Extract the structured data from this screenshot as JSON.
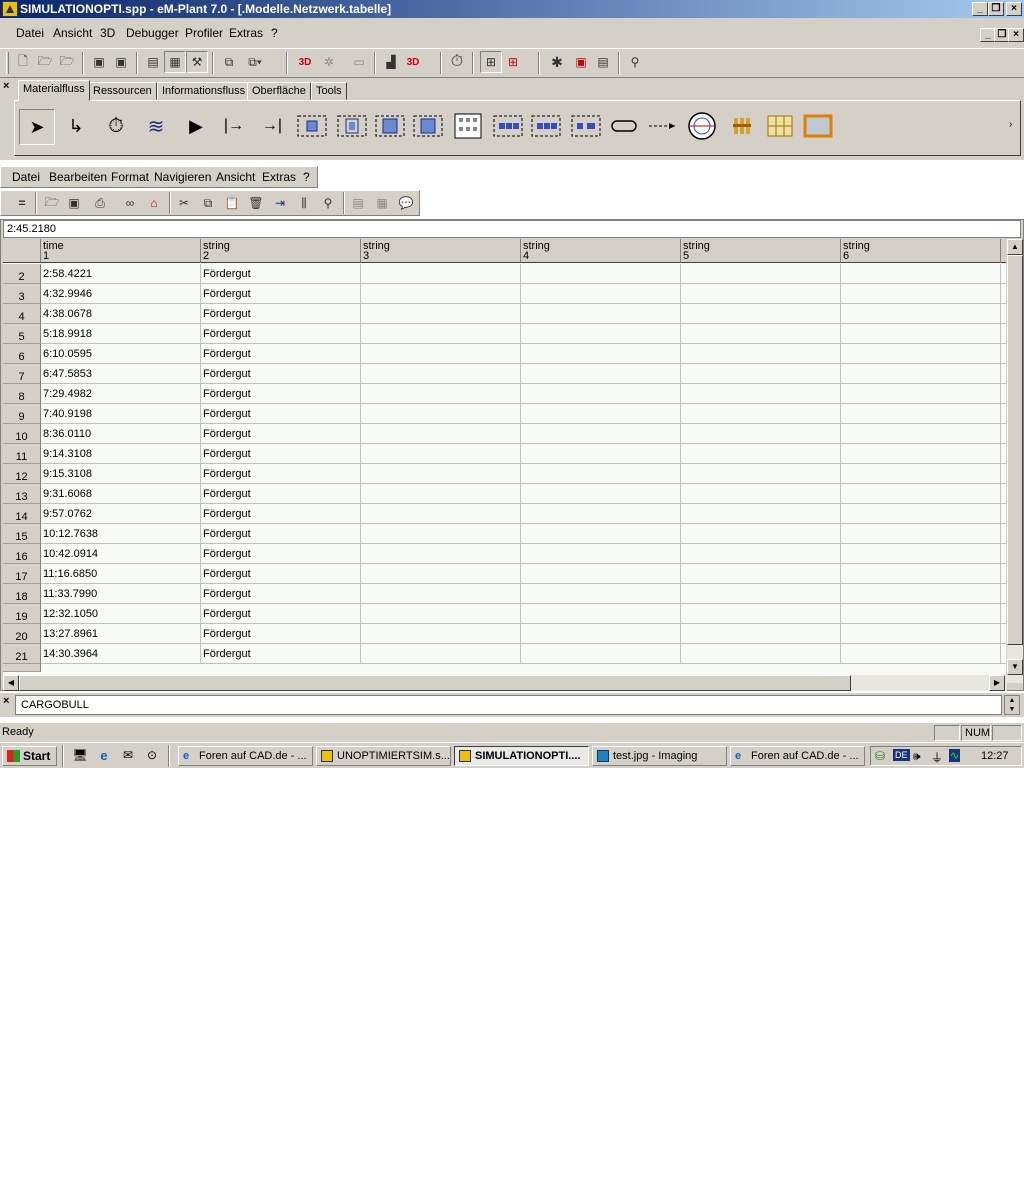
{
  "window": {
    "title": "SIMULATIONOPTI.spp - eM-Plant 7.0 - [.Modelle.Netzwerk.tabelle]",
    "buttons": [
      "_",
      "❐",
      "×"
    ]
  },
  "menu": {
    "items": [
      "Datei",
      "Ansicht",
      "3D",
      "Debugger",
      "Profiler",
      "Extras",
      "?"
    ]
  },
  "toolbar1": {
    "labels": {
      "btn3d": "3D",
      "btn3dlog": "3D"
    }
  },
  "library": {
    "tabs": [
      "Materialfluss",
      "Ressourcen",
      "Informationsfluss",
      "Oberfläche",
      "Tools"
    ],
    "active_tab": "Materialfluss"
  },
  "menu2": {
    "items": [
      "Datei",
      "Bearbeiten",
      "Format",
      "Navigieren",
      "Ansicht",
      "Extras",
      "?"
    ]
  },
  "table": {
    "edit_value": "2:45.2180",
    "columns": [
      {
        "type": "time",
        "index": "1"
      },
      {
        "type": "string",
        "index": "2"
      },
      {
        "type": "string",
        "index": "3"
      },
      {
        "type": "string",
        "index": "4"
      },
      {
        "type": "string",
        "index": "5"
      },
      {
        "type": "string",
        "index": "6"
      }
    ],
    "rows": [
      {
        "n": "2",
        "time": "2:58.4221",
        "s": "Fördergut"
      },
      {
        "n": "3",
        "time": "4:32.9946",
        "s": "Fördergut"
      },
      {
        "n": "4",
        "time": "4:38.0678",
        "s": "Fördergut"
      },
      {
        "n": "5",
        "time": "5:18.9918",
        "s": "Fördergut"
      },
      {
        "n": "6",
        "time": "6:10.0595",
        "s": "Fördergut"
      },
      {
        "n": "7",
        "time": "6:47.5853",
        "s": "Fördergut"
      },
      {
        "n": "8",
        "time": "7:29.4982",
        "s": "Fördergut"
      },
      {
        "n": "9",
        "time": "7:40.9198",
        "s": "Fördergut"
      },
      {
        "n": "10",
        "time": "8:36.0110",
        "s": "Fördergut"
      },
      {
        "n": "11",
        "time": "9:14.3108",
        "s": "Fördergut"
      },
      {
        "n": "12",
        "time": "9:15.3108",
        "s": "Fördergut"
      },
      {
        "n": "13",
        "time": "9:31.6068",
        "s": "Fördergut"
      },
      {
        "n": "14",
        "time": "9:57.0762",
        "s": "Fördergut"
      },
      {
        "n": "15",
        "time": "10:12.7638",
        "s": "Fördergut"
      },
      {
        "n": "16",
        "time": "10:42.0914",
        "s": "Fördergut"
      },
      {
        "n": "17",
        "time": "11:16.6850",
        "s": "Fördergut"
      },
      {
        "n": "18",
        "time": "11:33.7990",
        "s": "Fördergut"
      },
      {
        "n": "19",
        "time": "12:32.1050",
        "s": "Fördergut"
      },
      {
        "n": "20",
        "time": "13:27.8961",
        "s": "Fördergut"
      },
      {
        "n": "21",
        "time": "14:30.3964",
        "s": "Fördergut"
      }
    ]
  },
  "command_input": "CARGOBULL",
  "status": {
    "text": "Ready",
    "num": "NUM"
  },
  "taskbar": {
    "start": "Start",
    "tasks": [
      {
        "label": "Foren auf CAD.de - ...",
        "active": false
      },
      {
        "label": "UNOPTIMIERTSIM.s...",
        "active": false
      },
      {
        "label": "SIMULATIONOPTI....",
        "active": true
      },
      {
        "label": "test.jpg - Imaging",
        "active": false
      },
      {
        "label": "Foren auf CAD.de - ...",
        "active": false
      }
    ],
    "tray_lang": "DE",
    "clock": "12:27"
  }
}
